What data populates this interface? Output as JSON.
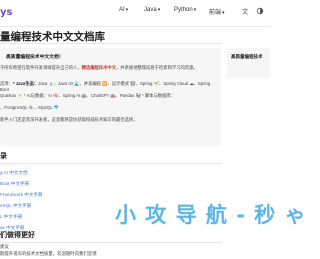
{
  "header": {
    "logo_text": "ys",
    "nav_items": [
      {
        "label": "AI"
      },
      {
        "label": "Java"
      },
      {
        "label": "Python"
      },
      {
        "label": "前端"
      }
    ]
  },
  "page": {
    "title": "量编程技术中文文档库"
  },
  "notice": {
    "heading": "高质量编程技术中文文档！",
    "line1_a": "于所有希望在软件开发领域提升自己的人，",
    "line1_red": "精选编程技术中文",
    "line1_b": "，并系统地整理成易于检索和学习的资源。",
    "line2_a": "选项：",
    "line2_bold": "* Java生态：",
    "line2_b": "Java 🍵、Java IO 🌊、并发编程 🔀、设计模式 🏗、Spring 🌱、Spring Cloud ☁、Spring Boot",
    "line3": "Quarkus ⚡ * AI与数据：AI 🧠、Spring AI 🤖、ChatGPT 🤖、Pandas 🐼 * 脚本与数据库：",
    "line4": "、PostgreSQL 🐘、MySQL 🐬",
    "line5": "新手入门还是资深开发者，这里都将是你获取权威技术知识的最佳选择。"
  },
  "side_card": {
    "label": "高质量编程技术"
  },
  "toc": {
    "title": "录",
    "items": [
      "g AI 中文文档",
      "Boot 中文手册",
      "Framework 中文手册",
      "eSQL 中文手册",
      "L 中文手册",
      "as 中文手册"
    ]
  },
  "next": {
    "title": "们做得更好",
    "line1": "建议",
    "line2": "期提升现有的技术文档质量，欢迎随时向我们反馈"
  },
  "watermark": {
    "text": "小 攻 导 航 - 秒 ゃ"
  },
  "colors": {
    "accent": "#6b4fbb",
    "link": "#4a7dc4",
    "highlight": "#d03a2f",
    "watermark": "#5bb5e6"
  }
}
